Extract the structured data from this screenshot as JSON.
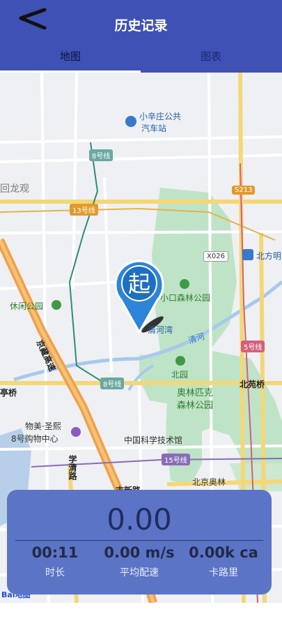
{
  "header": {
    "title": "历史记录",
    "tabs": [
      {
        "label": "地图",
        "active": true
      },
      {
        "label": "图表",
        "active": false
      }
    ]
  },
  "map": {
    "district_labels": [
      "回龙观"
    ],
    "poi_labels": [
      "小辛庄公共",
      "汽车站",
      "北方明",
      "清河湾",
      "奥林匹克",
      "森林公园",
      "中国科学技术馆",
      "北京奥林",
      "物美·圣熙",
      "8号购物中心"
    ],
    "green_labels": [
      "休闲公园",
      "小口森林公园",
      "北园"
    ],
    "road_labels": [
      "京藏高速",
      "学清路",
      "北苑桥",
      "清河",
      "亭桥",
      "志新路"
    ],
    "line_badges": [
      "8号线",
      "13号线",
      "8号线",
      "5号线",
      "15号线",
      "S213",
      "X026"
    ],
    "start_marker": "起",
    "logo": "Bai地图"
  },
  "stats": {
    "distance": "0.00",
    "duration": {
      "value": "00:11",
      "label": "时长"
    },
    "pace": {
      "value": "0.00 m/s",
      "label": "平均配速"
    },
    "calories": {
      "value": "0.00k ca",
      "label": "卡路里"
    }
  },
  "colors": {
    "header": "#3f51b5",
    "panel": "#5b74c6",
    "green": "#bfe3c6"
  }
}
